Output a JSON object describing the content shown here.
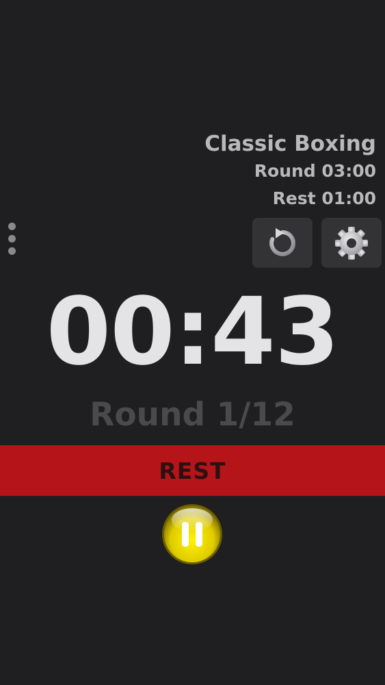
{
  "preset": {
    "title": "Classic Boxing",
    "round_duration": "Round 03:00",
    "rest_duration": "Rest 01:00"
  },
  "timer": {
    "display": "00:43"
  },
  "round": {
    "label": "Round 1/12"
  },
  "phase": {
    "label": "REST",
    "color": "#b51419"
  },
  "controls": {
    "reset_icon": "reset-icon",
    "settings_icon": "gear-icon",
    "menu_icon": "more-vertical-icon",
    "pause_icon": "pause-icon",
    "pause_color": "#e8d400"
  },
  "colors": {
    "background": "#1f1e20",
    "button_background": "#333235",
    "text_primary": "#e4e4e6",
    "text_secondary": "#b9b9bc",
    "text_dim": "#4a494c"
  }
}
